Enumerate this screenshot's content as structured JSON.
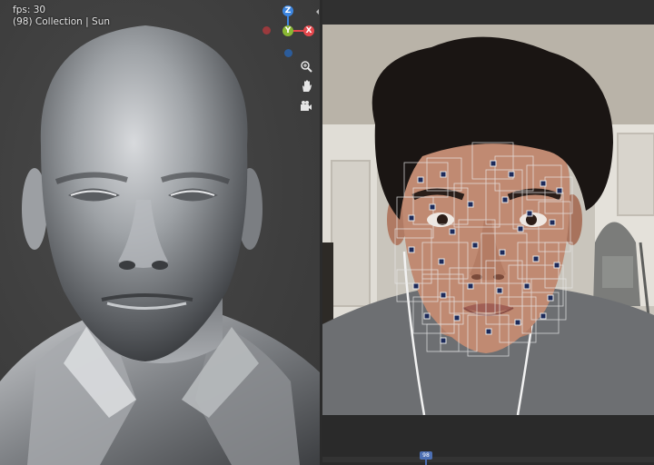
{
  "viewport": {
    "fps_text": "fps: 30",
    "collection_text": "(98) Collection | Sun"
  },
  "gizmo": {
    "z_label": "Z",
    "y_label": "Y",
    "x_label": "X",
    "colors": {
      "x": "#e5484d",
      "y": "#8ab833",
      "z": "#3d86e0"
    }
  },
  "nav_icons": [
    "zoom-icon",
    "hand-pan-icon",
    "camera-icon"
  ],
  "timeline": {
    "current_frame": "98"
  }
}
